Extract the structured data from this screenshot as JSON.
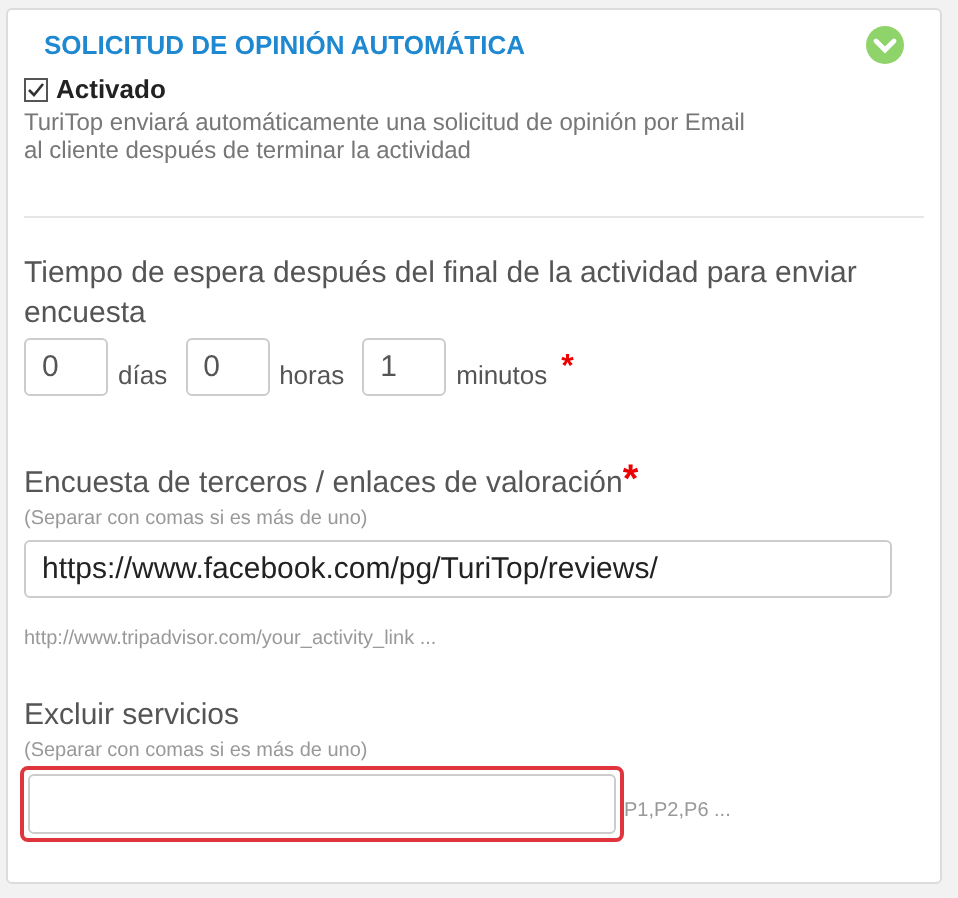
{
  "panel": {
    "title": "SOLICITUD DE OPINIÓN AUTOMÁTICA",
    "expanded": true
  },
  "activation": {
    "label": "Activado",
    "checked": true,
    "description": "TuriTop enviará automáticamente una solicitud de opinión por Email al cliente después de terminar la actividad"
  },
  "wait_time": {
    "label": "Tiempo de espera después del final de la actividad para enviar encuesta",
    "fields": [
      {
        "value": "0",
        "unit": "días"
      },
      {
        "value": "0",
        "unit": "horas"
      },
      {
        "value": "1",
        "unit": "minutos"
      }
    ],
    "required_mark": "*"
  },
  "review_links": {
    "label": "Encuesta de terceros / enlaces de valoración",
    "required_mark": "*",
    "hint": "(Separar con comas si es más de uno)",
    "value": "https://www.facebook.com/pg/TuriTop/reviews/",
    "example": "http://www.tripadvisor.com/your_activity_link ..."
  },
  "exclude_services": {
    "label": "Excluir servicios",
    "hint": "(Separar con comas si es más de uno)",
    "highlighted": true,
    "example": "P1,P2,P6 ..."
  }
}
